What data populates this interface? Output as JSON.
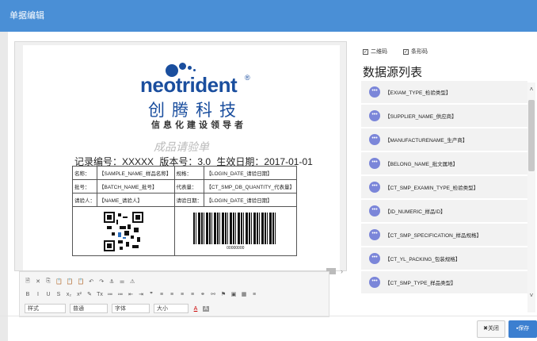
{
  "dialog": {
    "title": "单据编辑"
  },
  "document": {
    "logo": {
      "text": "neotrident",
      "reg_mark": "®",
      "cn_name": "创腾科技",
      "slogan": "信息化建设领导者"
    },
    "report_title": "成品请验单",
    "record_line": {
      "record_no": "记录编号：XXXXX",
      "version": "版本号：3.0",
      "effective_date": "生效日期：2017-01-01"
    },
    "table": {
      "rows": [
        [
          "名称：",
          "【SAMPLE_NAME_样品名称】",
          "规格：",
          "【LOGIN_DATE_请验日期】"
        ],
        [
          "批号：",
          "【BATCH_NAME_批号】",
          "代表量：",
          "【CT_SMP_DB_QUANTITY_代表量】"
        ],
        [
          "请验人：",
          "【NAME_请验人】",
          "请验日期：",
          "【LOGIN_DATE_请验日期】"
        ]
      ],
      "barcode_number": "00000000"
    }
  },
  "editor": {
    "row1": [
      "🗎",
      "✕",
      "⎘",
      "📋",
      "📋",
      "📋",
      "↶",
      "↷",
      "⚓",
      "⚌",
      "⚠"
    ],
    "row2": [
      "B",
      "I",
      "U",
      "S",
      "x₂",
      "x²",
      "✎",
      "Tx",
      "≔",
      "≔",
      "⇤",
      "⇥",
      "❞",
      "≡",
      "≡",
      "≡",
      "≡",
      "⚭",
      "⚯",
      "⚑",
      "▣",
      "▦",
      "≡"
    ],
    "style_select": "样式",
    "format_select": "普通",
    "font_select": "字体",
    "size_select": "大小",
    "text_color": "A",
    "bg_color": "A"
  },
  "sidepanel": {
    "qrcode_label": "二维码",
    "barcode_label": "条形码",
    "title": "数据源列表",
    "items": [
      "【EXIAM_TYPE_检验类型】",
      "【SUPPLIER_NAME_供应商】",
      "【MANUFACTURENAME_生产商】",
      "【BELONG_NAME_批文属地】",
      "【CT_SMP_EXAMIN_TYPE_检验类型】",
      "【ID_NUMERIC_样品ID】",
      "【CT_SMP_SPECIFICATION_样品规格】",
      "【CT_YL_PACKING_包装规格】",
      "【CT_SMP_TYPE_样品类型】"
    ]
  },
  "footer": {
    "close_label": "关闭",
    "save_label": "保存"
  },
  "colors": {
    "title_bar": "#4a8fd6",
    "brand": "#1a4e9e",
    "item_dot": "#7b86d9",
    "save_button": "#3c7fd0"
  }
}
